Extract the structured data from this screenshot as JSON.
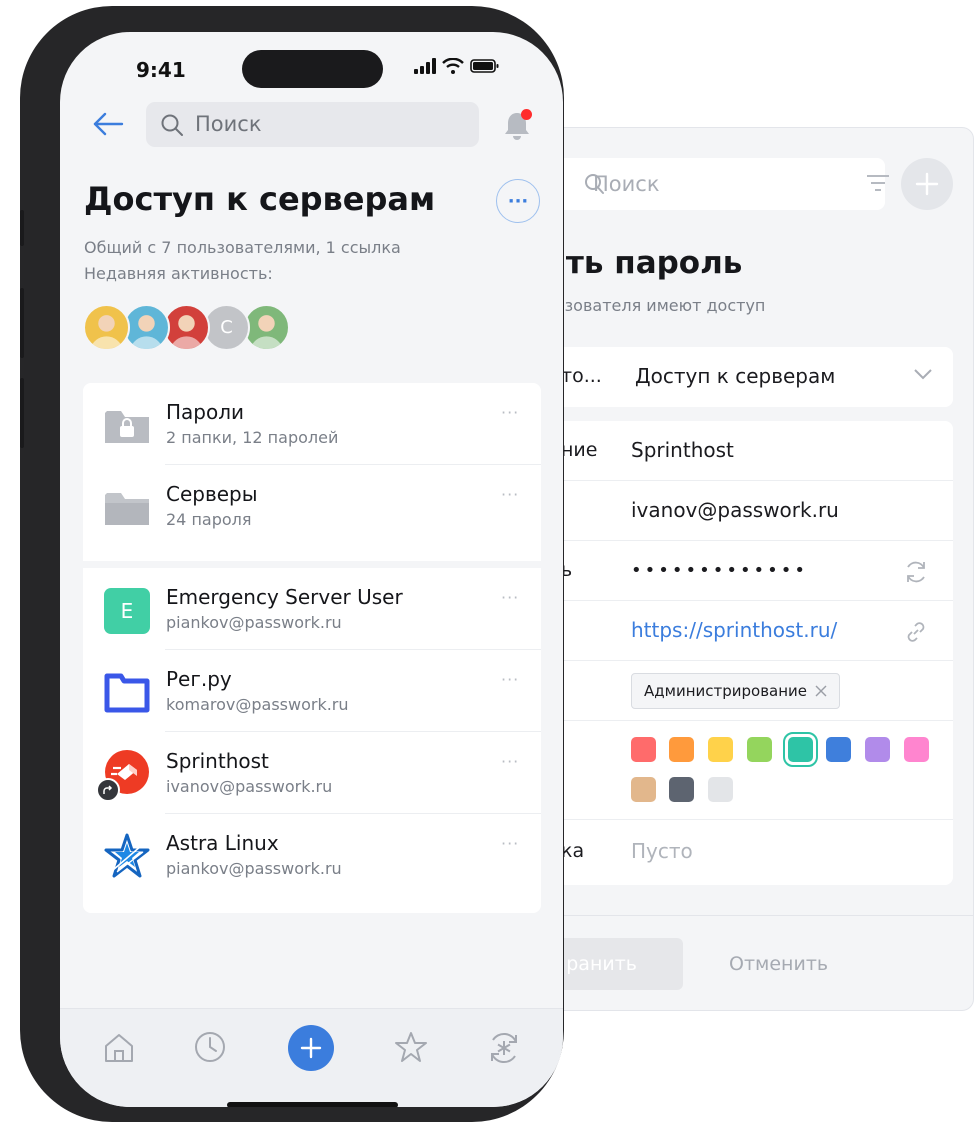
{
  "panel": {
    "search_placeholder": "Поиск",
    "title": "ать пароль",
    "subtitle": "льзователя имеют доступ",
    "folder_label": "то...",
    "folder_value": "Доступ к серверам",
    "fields": [
      {
        "label": "ние",
        "value": "Sprinthost"
      },
      {
        "label": "",
        "value": "ivanov@passwork.ru"
      },
      {
        "label": "ь",
        "value": "•••••••••••••"
      },
      {
        "label": "",
        "value": "https://sprinthost.ru/"
      },
      {
        "label": "",
        "tag": "Администрирование"
      },
      {
        "label": "ка",
        "value": "Пусто"
      }
    ],
    "colors": [
      "#ff6b6b",
      "#ff9a3c",
      "#ffd24a",
      "#94d55d",
      "#2ec4a6",
      "#3f7fdc",
      "#b18bea",
      "#ff85cf",
      "#e2b78c",
      "#5d6470",
      "#e3e5e8"
    ],
    "save_label": "ранить",
    "cancel_label": "Отменить"
  },
  "phone": {
    "status_time": "9:41",
    "search_placeholder": "Поиск",
    "title": "Доступ к серверам",
    "more_label": "···",
    "shared_text": "Общий с 7 пользователями, 1 ссылка",
    "activity_text": "Недавняя активность:",
    "avatars": [
      {
        "initial": "",
        "color": "#f0c24b"
      },
      {
        "initial": "",
        "color": "#5fb6d8"
      },
      {
        "initial": "",
        "color": "#d2403b"
      },
      {
        "initial": "С",
        "color": "#c2c4c8"
      },
      {
        "initial": "",
        "color": "#7fb87a"
      }
    ],
    "folders": [
      {
        "name": "Пароли",
        "sub": "2 папки, 12 паролей",
        "icon": "lock-folder-icon"
      },
      {
        "name": "Серверы",
        "sub": "24 пароля",
        "icon": "folder-icon"
      }
    ],
    "items": [
      {
        "name": "Emergency Server User",
        "sub": "piankov@passwork.ru",
        "icon": "letter-e-icon",
        "icon_letter": "E"
      },
      {
        "name": "Рег.ру",
        "sub": "komarov@passwork.ru",
        "icon": "regru-icon"
      },
      {
        "name": "Sprinthost",
        "sub": "ivanov@passwork.ru",
        "icon": "sprinthost-icon"
      },
      {
        "name": "Astra Linux",
        "sub": "piankov@passwork.ru",
        "icon": "astra-linux-icon"
      }
    ],
    "row_more": "···",
    "accent": "#3b7ddd"
  }
}
